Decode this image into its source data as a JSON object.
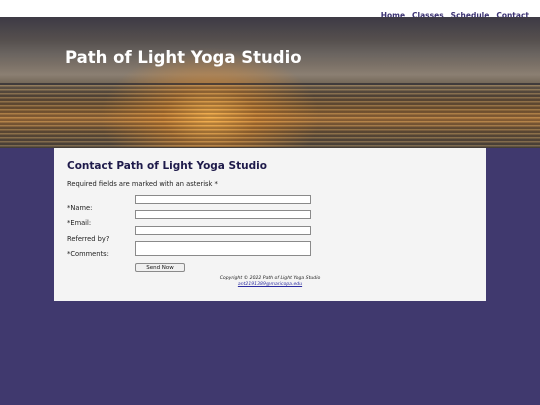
{
  "nav": {
    "items": [
      "Home",
      "Classes",
      "Schedule",
      "Contact"
    ]
  },
  "header": {
    "title": "Path of Light Yoga Studio"
  },
  "main": {
    "heading": "Contact Path of Light Yoga Studio",
    "required_note": "Required fields are marked with an asterisk *",
    "fields": {
      "name_label": "*Name:",
      "email_label": "*Email:",
      "referred_label": "Referred by?",
      "comments_label": "*Comments:"
    },
    "send_label": "Send Now"
  },
  "footer": {
    "copyright": "Copyright © 2022 Path of Light Yoga Studio",
    "email": "ant2191389@maricopa.edu"
  },
  "colors": {
    "background": "#40396e",
    "accent": "#3b3272"
  }
}
